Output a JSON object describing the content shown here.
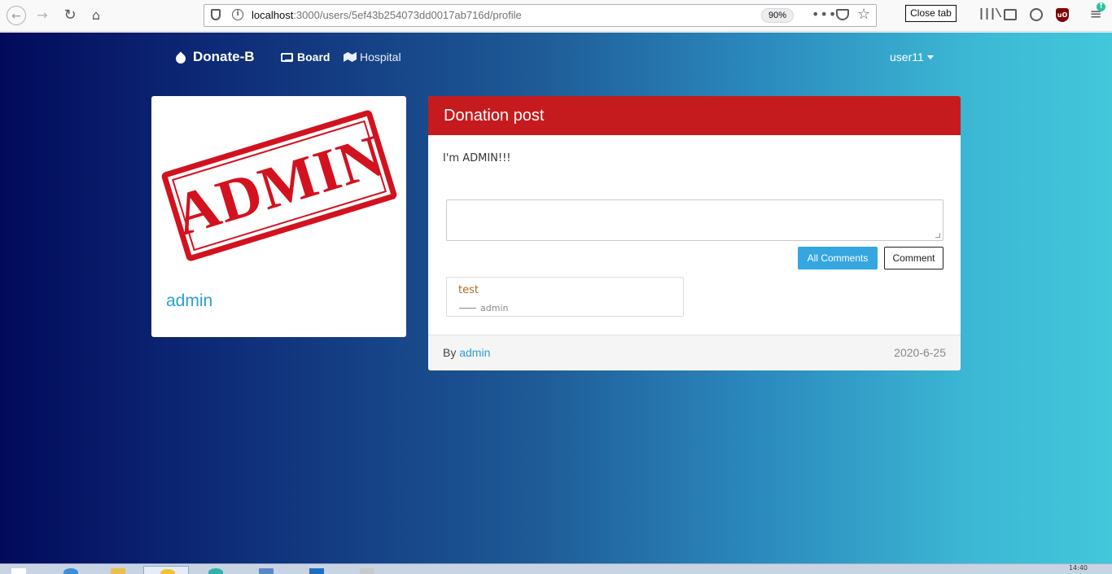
{
  "browser": {
    "url_host": "localhost",
    "url_path": ":3000/users/5ef43b254073dd0017ab716d/profile",
    "zoom": "90%",
    "close_tab_label": "Close tab",
    "url_dots": "•••"
  },
  "navbar": {
    "brand": "Donate-B",
    "links": [
      {
        "label": "Board",
        "icon": "board-icon"
      },
      {
        "label": "Hospital",
        "icon": "hospital-icon"
      }
    ],
    "user": "user11"
  },
  "profile": {
    "stamp_text": "ADMIN",
    "name": "admin"
  },
  "post": {
    "header": "Donation post",
    "body": "I'm ADMIN!!!",
    "comment_placeholder": "",
    "all_comments_label": "All Comments",
    "comment_button_label": "Comment",
    "comments": [
      {
        "text": "test",
        "author": "admin"
      }
    ],
    "footer": {
      "by_label": "By",
      "author": "admin",
      "date": "2020-6-25"
    }
  },
  "taskbar": {
    "clock": "14:40"
  },
  "colors": {
    "header_red": "#c51b1e",
    "accent_blue": "#35a6e0",
    "link_blue": "#2a9fd0",
    "stamp_red": "#d3121f"
  }
}
